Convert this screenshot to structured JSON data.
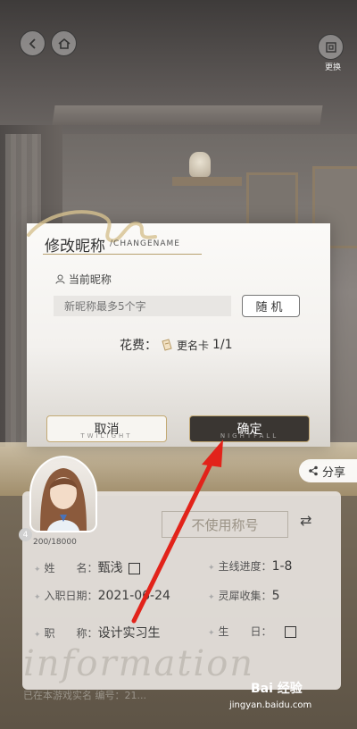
{
  "topbar": {
    "switch_label": "更换"
  },
  "dialog": {
    "title": "修改昵称",
    "title_en": "/CHANGENAME",
    "current_label": "当前昵称",
    "input_placeholder": "新昵称最多5个字",
    "random_label": "随机",
    "cost_label": "花费：",
    "cost_item": "更名卡",
    "cost_count": "1/1",
    "cancel_label": "取消",
    "cancel_sub": "TWILIGHT",
    "confirm_label": "确定",
    "confirm_sub": "NIGHTFALL"
  },
  "profile": {
    "level": "4",
    "exp": "200/18000",
    "title_label": "不使用称号",
    "share_label": "分享",
    "rows": {
      "name_label": "姓　　名：",
      "name_value": "甄浅",
      "join_label": "入职日期：",
      "join_value": "2021-06-24",
      "job_label": "职　　称：",
      "job_value": "设计实习生",
      "progress_label": "主线进度：",
      "progress_value": "1-8",
      "collect_label": "灵犀收集：",
      "collect_value": "5",
      "birthday_label": "生　　日："
    },
    "footer": "已在本游戏实名  编号：21...",
    "script_watermark": "information"
  },
  "watermark": {
    "brand": "Bai 经验",
    "url": "jingyan.baidu.com"
  }
}
